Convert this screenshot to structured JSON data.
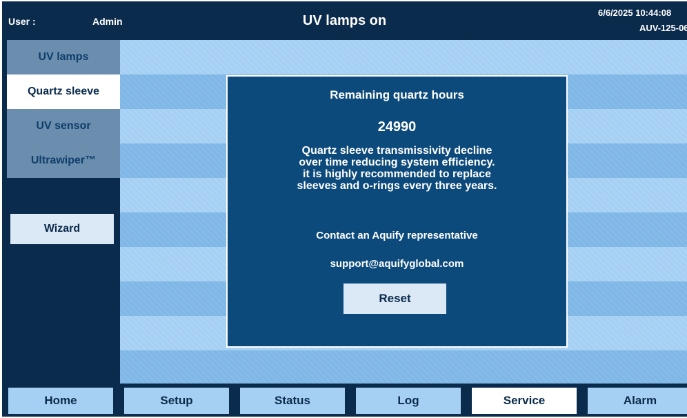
{
  "header": {
    "user_label": "User :",
    "user_name": "Admin",
    "title": "UV lamps on",
    "datetime": "6/6/2025 10:44:08",
    "device_id": "AUV-125-06"
  },
  "sidebar": {
    "tabs": [
      {
        "label": "UV lamps",
        "active": false
      },
      {
        "label": "Quartz sleeve",
        "active": true
      },
      {
        "label": "UV sensor",
        "active": false
      },
      {
        "label": "Ultrawiper™",
        "active": false
      }
    ],
    "wizard_label": "Wizard"
  },
  "dialog": {
    "title": "Remaining quartz hours",
    "hours": "24990",
    "message_lines": [
      "Quartz sleeve transmissivity decline",
      "over time reducing system efficiency.",
      "it is highly recommended to replace",
      "sleeves and o-rings every three years."
    ],
    "contact": "Contact an Aquify representative",
    "email": "support@aquifyglobal.com",
    "reset_label": "Reset"
  },
  "footer": {
    "nav": [
      {
        "label": "Home",
        "active": false
      },
      {
        "label": "Setup",
        "active": false
      },
      {
        "label": "Status",
        "active": false
      },
      {
        "label": "Log",
        "active": false
      },
      {
        "label": "Service",
        "active": true
      },
      {
        "label": "Alarm",
        "active": false
      }
    ]
  },
  "colors": {
    "header_bg": "#0b2b4c",
    "dialog_bg": "#0d4a7c",
    "stripe_light": "#a6d0f3",
    "stripe_dark": "#7fb7e6",
    "tab_inactive": "#6b8eae",
    "active_bg": "#ffffff"
  }
}
